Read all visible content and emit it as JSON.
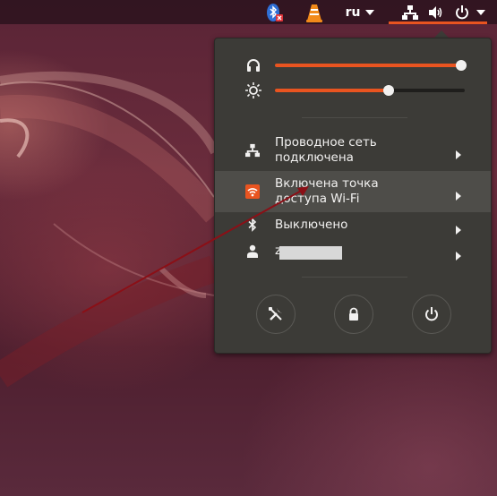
{
  "top_panel": {
    "language": "ru",
    "indicators": [
      "bluetooth-disabled-icon",
      "vlc-icon",
      "network-wired-icon",
      "volume-icon",
      "power-icon"
    ]
  },
  "system_menu": {
    "volume_level": 0.98,
    "brightness_level": 0.6,
    "items": [
      {
        "label": "Проводное сеть\nподключена",
        "icon": "network-wired-icon"
      },
      {
        "label": "Включена точка\nдоступа Wi-Fi",
        "icon": "wifi-hotspot-icon",
        "highlighted": true
      },
      {
        "label": "Выключено",
        "icon": "bluetooth-icon"
      },
      {
        "label": "z",
        "icon": "user-icon"
      }
    ],
    "buttons": [
      "settings-icon",
      "lock-icon",
      "power-icon"
    ]
  },
  "colors": {
    "accent": "#e95420",
    "menu_bg": "#3c3b37",
    "text": "#f2f1f0"
  }
}
